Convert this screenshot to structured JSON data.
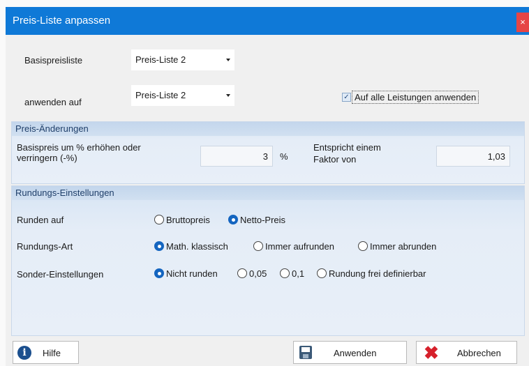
{
  "window": {
    "title": "Preis-Liste anpassen",
    "close_glyph": "×"
  },
  "top": {
    "base_label": "Basispreisliste",
    "base_value": "Preis-Liste 2",
    "apply_label": "anwenden auf",
    "apply_value": "Preis-Liste 2",
    "all_services_checked": true,
    "all_services_label": "Auf alle Leistungen anwenden"
  },
  "price_changes": {
    "header": "Preis-Änderungen",
    "percent_label_1": "Basispreis um % erhöhen oder",
    "percent_label_2": "verringern (-%)",
    "percent_value": "3",
    "percent_unit": "%",
    "factor_label_1": "Entspricht einem",
    "factor_label_2": "Faktor von",
    "factor_value": "1,03"
  },
  "rounding": {
    "header": "Rundungs-Einstellungen",
    "round_on_label": "Runden auf",
    "round_on_options": [
      "Bruttopreis",
      "Netto-Preis"
    ],
    "round_on_selected": "Netto-Preis",
    "type_label": "Rundungs-Art",
    "type_options": [
      "Math. klassisch",
      "Immer aufrunden",
      "Immer abrunden"
    ],
    "type_selected": "Math. klassisch",
    "special_label": "Sonder-Einstellungen",
    "special_options": [
      "Nicht runden",
      "0,05",
      "0,1",
      "Rundung frei definierbar"
    ],
    "special_selected": "Nicht runden"
  },
  "buttons": {
    "help": "Hilfe",
    "apply": "Anwenden",
    "cancel": "Abbrechen"
  },
  "icons": {
    "help": "info-icon",
    "apply": "save-icon",
    "cancel": "close-x-icon",
    "accent_color": "#0f79d7"
  }
}
